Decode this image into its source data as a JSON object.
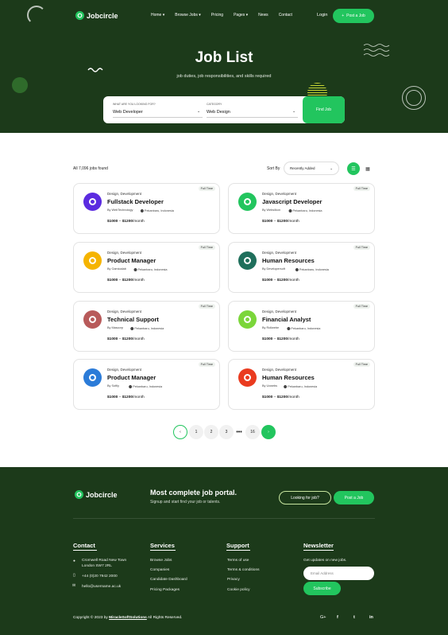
{
  "brand": {
    "name": "Jobcircle"
  },
  "nav": {
    "items": [
      {
        "label": "Home",
        "chevron": true
      },
      {
        "label": "Browse Jobs",
        "chevron": true
      },
      {
        "label": "Pricing",
        "chevron": false
      },
      {
        "label": "Pages",
        "chevron": true
      },
      {
        "label": "News",
        "chevron": false
      },
      {
        "label": "Contact",
        "chevron": false
      }
    ],
    "login": "Login",
    "post_job": "Post a Job"
  },
  "hero": {
    "title": "Job List",
    "subtitle": "job duties, job responsibilities, and skills required"
  },
  "search": {
    "keyword_label": "WHAT ARE YOU LOOKING FOR?",
    "keyword_value": "Web Developer",
    "category_label": "CATEGORY",
    "category_value": "Web Design",
    "find_button": "Find Job"
  },
  "toolbar": {
    "found": "All 7,096 jobs found",
    "sort_label": "Sort By",
    "sort_value": "Recently Added"
  },
  "jobs": [
    {
      "category": "Design, Development",
      "title": "Fullstack Developer",
      "company": "By WebTechnology",
      "location": "Pekanbaru, Indonesia",
      "salary_low": "$1000",
      "salary_high": "$1200",
      "period": "/month",
      "type": "Full Time",
      "logo": "n-logo-icon",
      "color": "#5b2be0"
    },
    {
      "category": "Design, Development",
      "title": "Javascript Developer",
      "company": "By Websilkon",
      "location": "Pekanbaru, Indonesia",
      "salary_low": "$1000",
      "salary_high": "$1200",
      "period": "/month",
      "type": "Full Time",
      "logo": "d-logo-icon",
      "color": "#22c55e"
    },
    {
      "category": "Design, Development",
      "title": "Product Manager",
      "company": "By Gamioalab",
      "location": "Pekanbaru, Indonesia",
      "salary_low": "$1000",
      "salary_high": "$1200",
      "period": "/month",
      "type": "Full Time",
      "logo": "m-logo-icon",
      "color": "#f5b400"
    },
    {
      "category": "Design, Development",
      "title": "Human Resources",
      "company": "By Developersoft",
      "location": "Pekanbaru, Indonesia",
      "salary_low": "$1000",
      "salary_high": "$1200",
      "period": "/month",
      "type": "Full Time",
      "logo": "e-logo-icon",
      "color": "#1f6f5c"
    },
    {
      "category": "Design, Development",
      "title": "Technical Support",
      "company": "By Mascorp",
      "location": "Pekanbaru, Indonesia",
      "salary_low": "$1000",
      "salary_high": "$1200",
      "period": "/month",
      "type": "Full Time",
      "logo": "swirl-logo-icon",
      "color": "#b85a5a"
    },
    {
      "category": "Design, Development",
      "title": "Financial Analyst",
      "company": "By Rollwebe",
      "location": "Pekanbaru, Indonesia",
      "salary_low": "$1000",
      "salary_high": "$1200",
      "period": "/month",
      "type": "Full Time",
      "logo": "flower-logo-icon",
      "color": "#7bd63a"
    },
    {
      "category": "Design, Development",
      "title": "Product Manager",
      "company": "By Softly",
      "location": "Pekanbaru, Indonesia",
      "salary_low": "$1000",
      "salary_high": "$1200",
      "period": "/month",
      "type": "Full Time",
      "logo": "stripes-logo-icon",
      "color": "#2b7bd8"
    },
    {
      "category": "Design, Development",
      "title": "Human Resources",
      "company": "By Uxwebs",
      "location": "Pekanbaru, Indonesia",
      "salary_low": "$1000",
      "salary_high": "$1200",
      "period": "/month",
      "type": "Full Time",
      "logo": "m-red-logo-icon",
      "color": "#ea3b1f"
    }
  ],
  "pagination": {
    "prev": "‹",
    "pages": [
      "1",
      "2",
      "3",
      "•••",
      "16"
    ],
    "next": "›"
  },
  "footer": {
    "tagline": "Most complete job portal.",
    "tagline_sub": "Signup and start find your job or talents.",
    "looking_btn": "Looking for job?",
    "post_btn": "Post a Job",
    "contact": {
      "heading": "Contact",
      "address_line1": "Cromwell Road New Town",
      "address_line2": "London SW7 2RL",
      "phone": "+44 (0)20 7942 2000",
      "email": "hello@username.ac.uk"
    },
    "services": {
      "heading": "Services",
      "links": [
        "Browse Jobs",
        "Companies",
        "Candidate Dashboard",
        "Pricing Packages"
      ]
    },
    "support": {
      "heading": "Support",
      "links": [
        "Terms of use",
        "Terms & conditions",
        "Privacy",
        "Cookie policy"
      ]
    },
    "newsletter": {
      "heading": "Newsletter",
      "text": "Get updates on new jobs.",
      "placeholder": "Email Address",
      "button": "Subscribe"
    },
    "copyright_pre": "Copyright © 2023 by ",
    "copyright_brand": "MiracleSoftSolutions",
    "copyright_post": " All Rights Reserved.",
    "social": [
      "G+",
      "f",
      "t",
      "in"
    ]
  },
  "colors": {
    "primary": "#22c55e",
    "dark": "#1c3a1a"
  }
}
